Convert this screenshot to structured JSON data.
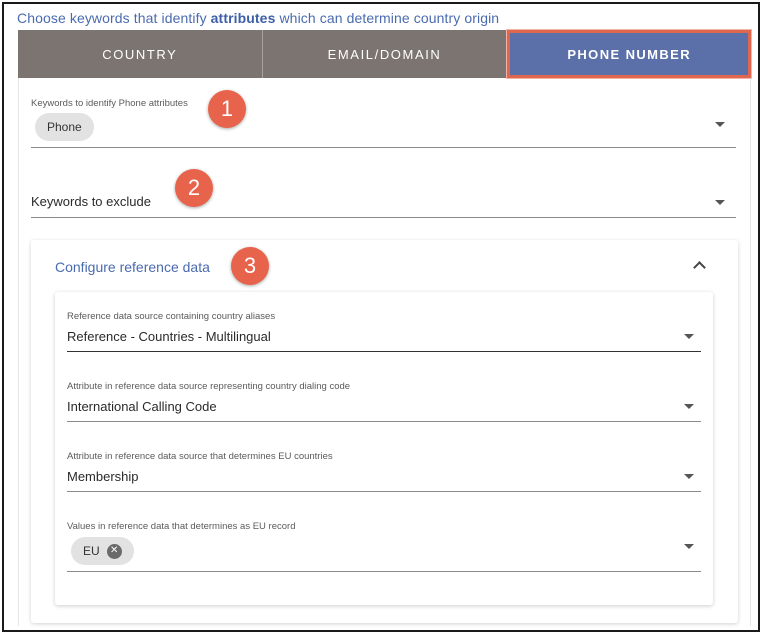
{
  "header": {
    "prefix": "Choose keywords that identify",
    "emphasis": "attributes",
    "suffix": "which can determine country origin"
  },
  "tabs": [
    {
      "label": "COUNTRY",
      "active": false
    },
    {
      "label": "EMAIL/DOMAIN",
      "active": false
    },
    {
      "label": "PHONE NUMBER",
      "active": true
    }
  ],
  "keywords_field": {
    "label": "Keywords to identify Phone attributes",
    "chips": [
      "Phone"
    ]
  },
  "exclude_field": {
    "label": "Keywords to exclude"
  },
  "badges": [
    "1",
    "2",
    "3"
  ],
  "reference_panel": {
    "title": "Configure reference data",
    "fields": [
      {
        "label": "Reference data source containing country aliases",
        "value": "Reference - Countries - Multilingual"
      },
      {
        "label": "Attribute in reference data source representing country dialing code",
        "value": "International Calling Code"
      },
      {
        "label": "Attribute in reference data source that determines EU countries",
        "value": "Membership"
      },
      {
        "label": "Values in reference data that determines as EU record",
        "chips": [
          "EU"
        ]
      }
    ]
  },
  "colors": {
    "accent": "#4a6bb0",
    "active_tab": "#5b6fa9",
    "tab_bar": "#7b7470",
    "badge": "#e8634c",
    "highlight": "#e0674f"
  },
  "icons": {
    "dropdown": "chevron-down-icon",
    "collapse": "chevron-up-icon",
    "chip_remove": "close-circle-icon"
  }
}
